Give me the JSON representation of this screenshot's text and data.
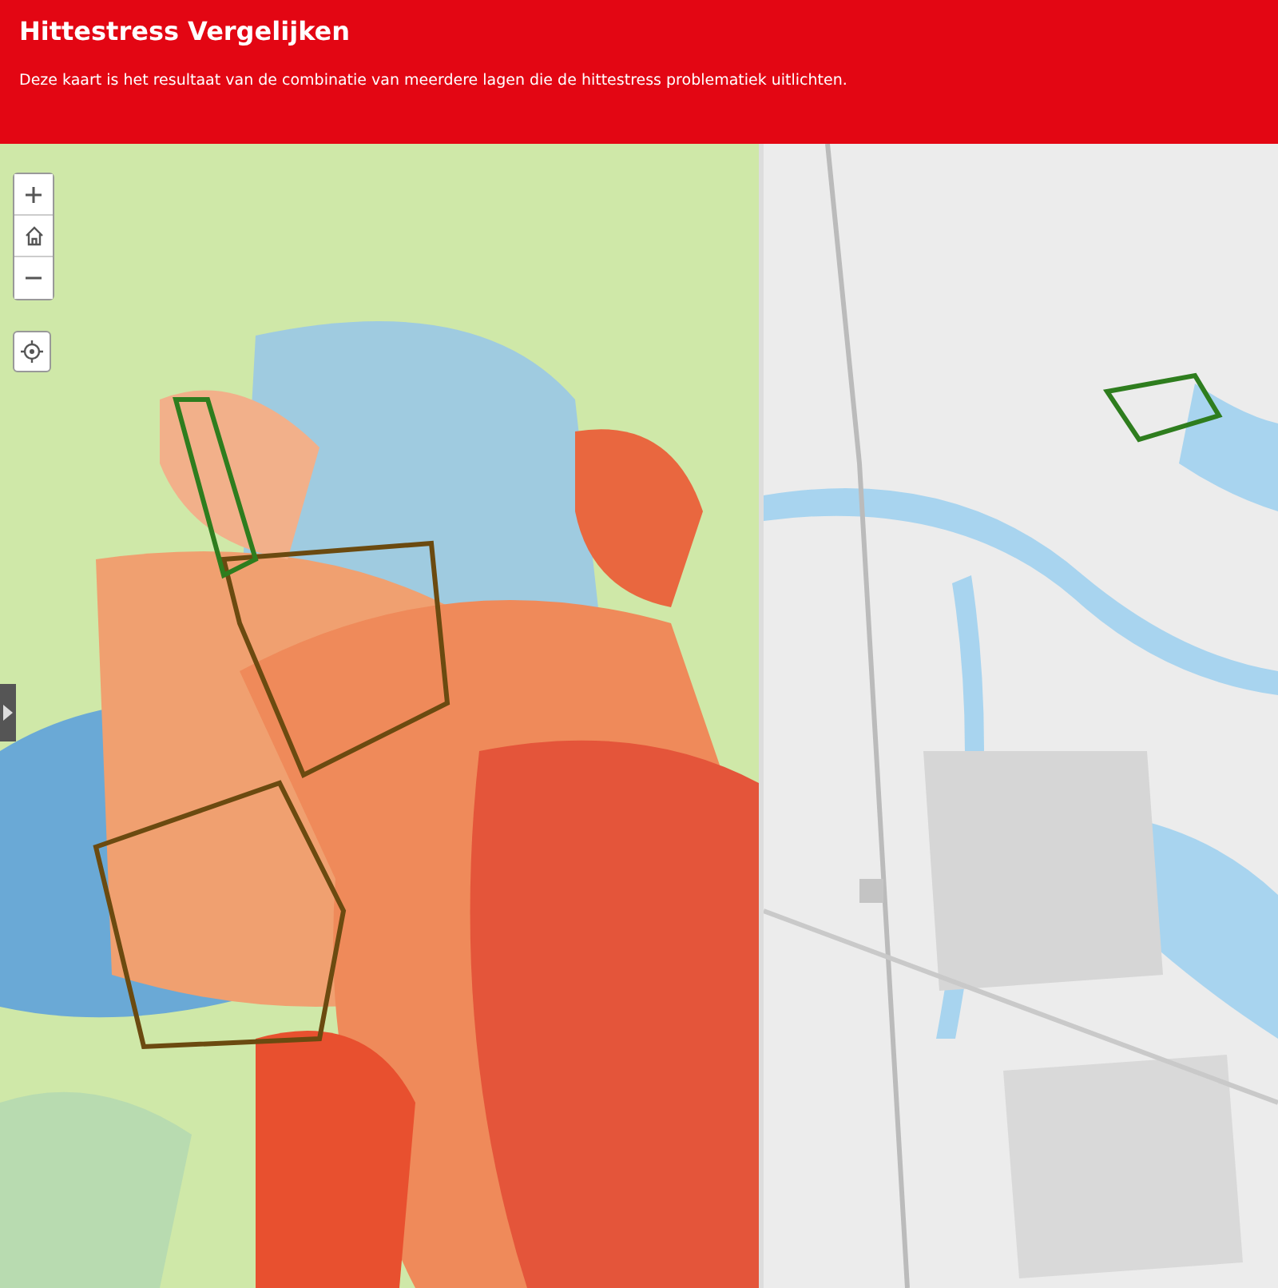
{
  "header": {
    "title": "Hittestress Vergelijken",
    "description": "Deze kaart is het resultaat van de combinatie van meerdere lagen die de hittestress problematiek uitlichten."
  }
}
